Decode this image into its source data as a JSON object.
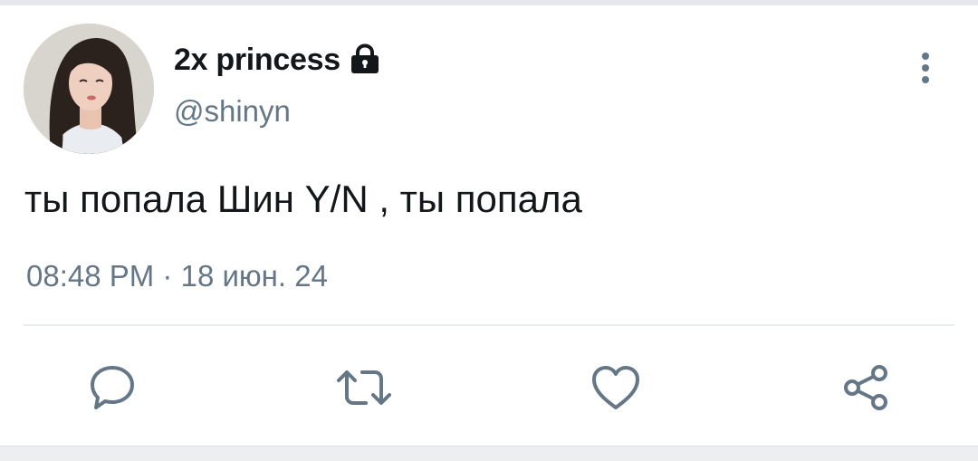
{
  "tweet": {
    "author": {
      "display_name": "2x princess",
      "handle": "@shinyn",
      "protected_icon": "lock-icon",
      "avatar": "profile-photo"
    },
    "text": "ты попала Шин Y/N , ты попала",
    "time": "08:48 PM",
    "separator": "·",
    "date": "18 июн. 24",
    "menu_icon": "vertical-dots-icon"
  },
  "actions": [
    {
      "name": "reply",
      "icon": "comment-icon"
    },
    {
      "name": "retweet",
      "icon": "retweet-icon"
    },
    {
      "name": "like",
      "icon": "heart-icon"
    },
    {
      "name": "share",
      "icon": "share-icon"
    }
  ],
  "colors": {
    "text_primary": "#14171a",
    "text_secondary": "#657786",
    "icon": "#657786",
    "divider": "#e6ecf0"
  }
}
